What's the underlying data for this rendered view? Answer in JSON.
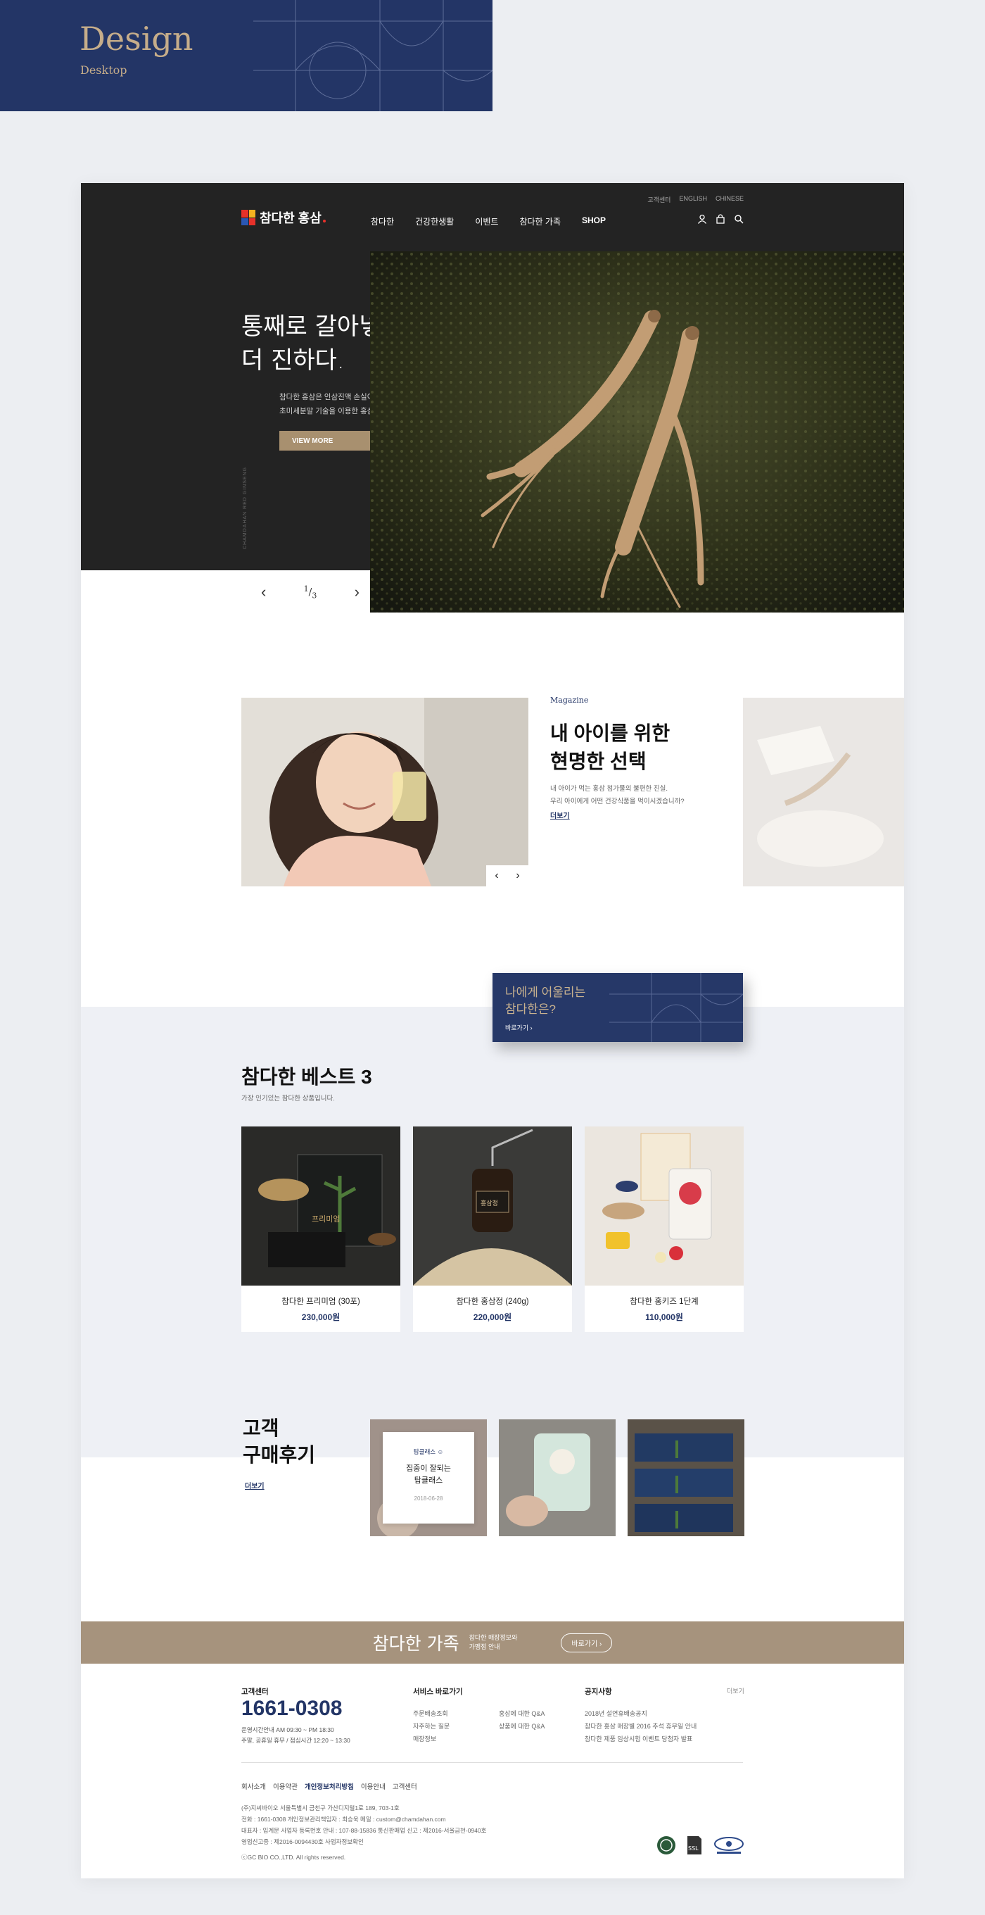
{
  "design_tag": {
    "title": "Design",
    "subtitle": "Desktop"
  },
  "header": {
    "util_links": [
      "고객센터",
      "ENGLISH",
      "CHINESE"
    ],
    "logo": "참다한 홍삼",
    "nav": [
      "참다한",
      "건강한생활",
      "이벤트",
      "참다한 가족",
      "SHOP"
    ],
    "icons": [
      "user-icon",
      "bag-icon",
      "search-icon"
    ]
  },
  "hero": {
    "title_line1": "통째로 갈아넣어",
    "title_line2": "더 진하다.",
    "desc_line1": "참다한 홍삼은 인삼진액 손실이 없는",
    "desc_line2": "초미세분말 기술을 이용한 홍삼 분말로 만듭니다.",
    "button": "VIEW MORE",
    "vertical_text": "CHAMDAHAN RED GINSENG",
    "slide_current": "1",
    "slide_total": "3"
  },
  "magazine": {
    "label": "Magazine",
    "title_line1": "내 아이를 위한",
    "title_line2": "현명한 선택",
    "desc_line1": "내 아이가 먹는 홍삼 첨가물의 불편한 진실.",
    "desc_line2": "우리 아이에게 어떤 건강식품을 먹이시겠습니까?",
    "more": "더보기"
  },
  "banner": {
    "line1": "나에게 어울리는",
    "line2": "참다한은?",
    "link": "바로가기"
  },
  "best": {
    "title": "참다한 베스트 3",
    "subtitle": "가장 인기있는 참다한 상품입니다.",
    "products": [
      {
        "name": "참다한 프리미엄 (30포)",
        "price": "230,000원"
      },
      {
        "name": "참다한 홍삼정 (240g)",
        "price": "220,000원"
      },
      {
        "name": "참다한 홍키즈 1단계",
        "price": "110,000원"
      }
    ]
  },
  "reviews": {
    "title_line1": "고객",
    "title_line2": "구매후기",
    "more": "더보기",
    "card": {
      "tag": "탑클래스 ☺",
      "title_line1": "집중이 잘되는",
      "title_line2": "탑클래스",
      "date": "2018-06-28"
    }
  },
  "family": {
    "title": "참다한 가족",
    "desc_line1": "참다한 매장정보와",
    "desc_line2": "가맹점 안내",
    "button": "바로가기"
  },
  "footer": {
    "cs_title": "고객센터",
    "phone": "1661-0308",
    "hours_line1": "운영시간안내 AM 09:30 ~ PM 18:30",
    "hours_line2": "주말, 공휴일 휴무 / 점심시간 12:20 ~ 13:30",
    "service_title": "서비스 바로가기",
    "service_col1": [
      "주문배송조회",
      "자주하는 질문",
      "매장정보"
    ],
    "service_col2": [
      "홍삼에 대한 Q&A",
      "상품에 대한 Q&A"
    ],
    "notice_title": "공지사항",
    "notice_more": "더보기",
    "notices": [
      "2018년 설연휴배송공지",
      "참다한 홍삼 매장별 2016 추석 휴무일 안내",
      "참다한 제품 임상시험 이벤트 당첨자 발표"
    ],
    "bottom_links": [
      "회사소개",
      "이용약관",
      "개인정보처리방침",
      "이용안내",
      "고객센터"
    ],
    "info_line1": "(주)지씨바이오 서울특별시 금천구 가산디지털1로 189, 703-1호",
    "info_line2": "전화 : 1661-0308    개인정보관리책임자 : 최승욱    메일 : custom@chamdahan.com",
    "info_line3": "대표자 : 임계문    사업자 등록번호 안내 : 107-88-15836    통신판매업 신고 : 제2016-서울금천-0940호",
    "info_line4": "영업신고증 : 제2016-0094430호  사업자정보확인",
    "copyright": "ⓒGC BIO CO.,LTD. All rights reserved.",
    "badges": [
      "certification-icon",
      "ssl-icon",
      "trust-icon"
    ],
    "ssl_text": "SSL"
  },
  "colors": {
    "navy": "#233566",
    "gold": "#a8906f",
    "dark": "#232323",
    "family": "#a6937d"
  }
}
